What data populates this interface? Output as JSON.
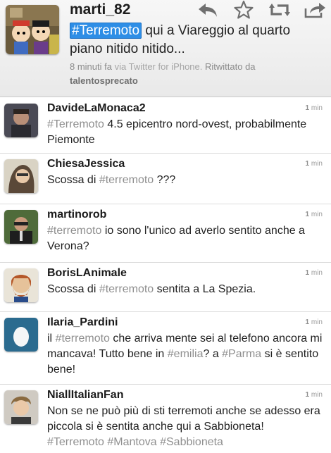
{
  "header": {
    "username": "marti_82",
    "text_tag": "#Terremoto",
    "text_rest": " qui a Viareggio al quarto piano nitido nitido...",
    "meta_time": "8 minuti fa",
    "meta_via": "via Twitter for iPhone.",
    "meta_retweeted": "Ritwittato da",
    "meta_retweeter": "talentosprecato",
    "actions": [
      "reply-icon",
      "favorite-star-icon",
      "retweet-icon",
      "share-icon"
    ]
  },
  "tweets": [
    {
      "user": "DavideLaMonaca2",
      "time_num": "1",
      "time_unit": "min",
      "parts": [
        {
          "t": "#Terremoto",
          "tag": true
        },
        {
          "t": " 4.5 epicentro nord-ovest, probabilmente Piemonte",
          "tag": false
        }
      ]
    },
    {
      "user": "ChiesaJessica",
      "time_num": "1",
      "time_unit": "min",
      "parts": [
        {
          "t": "Scossa di ",
          "tag": false
        },
        {
          "t": "#terremoto",
          "tag": true
        },
        {
          "t": " ???",
          "tag": false
        }
      ]
    },
    {
      "user": "martinorob",
      "time_num": "1",
      "time_unit": "min",
      "parts": [
        {
          "t": "#terremoto",
          "tag": true
        },
        {
          "t": " io sono l'unico ad averlo sentito anche a Verona?",
          "tag": false
        }
      ]
    },
    {
      "user": "BorisLAnimale",
      "time_num": "1",
      "time_unit": "min",
      "parts": [
        {
          "t": "Scossa di ",
          "tag": false
        },
        {
          "t": "#terremoto",
          "tag": true
        },
        {
          "t": " sentita a La Spezia.",
          "tag": false
        }
      ]
    },
    {
      "user": "Ilaria_Pardini",
      "time_num": "1",
      "time_unit": "min",
      "parts": [
        {
          "t": "il ",
          "tag": false
        },
        {
          "t": "#terremoto",
          "tag": true
        },
        {
          "t": " che arriva mente sei al telefono ancora mi mancava! Tutto bene in ",
          "tag": false
        },
        {
          "t": "#emilia",
          "tag": true
        },
        {
          "t": "? a ",
          "tag": false
        },
        {
          "t": "#Parma",
          "tag": true
        },
        {
          "t": " si è sentito bene!",
          "tag": false
        }
      ]
    },
    {
      "user": "NiallItalianFan",
      "time_num": "1",
      "time_unit": "min",
      "parts": [
        {
          "t": "Non se ne può più di sti terremoti anche se adesso era piccola si è sentita anche qui a Sabbioneta! ",
          "tag": false
        },
        {
          "t": "#Terremoto",
          "tag": true
        },
        {
          "t": " ",
          "tag": false
        },
        {
          "t": "#Mantova",
          "tag": true
        },
        {
          "t": " ",
          "tag": false
        },
        {
          "t": "#Sabbioneta",
          "tag": true
        }
      ]
    }
  ],
  "colors": {
    "hashtag": "#8f8f8f",
    "selected_hashtag_bg": "#2e8ee6",
    "header_bg": "#efefef"
  }
}
